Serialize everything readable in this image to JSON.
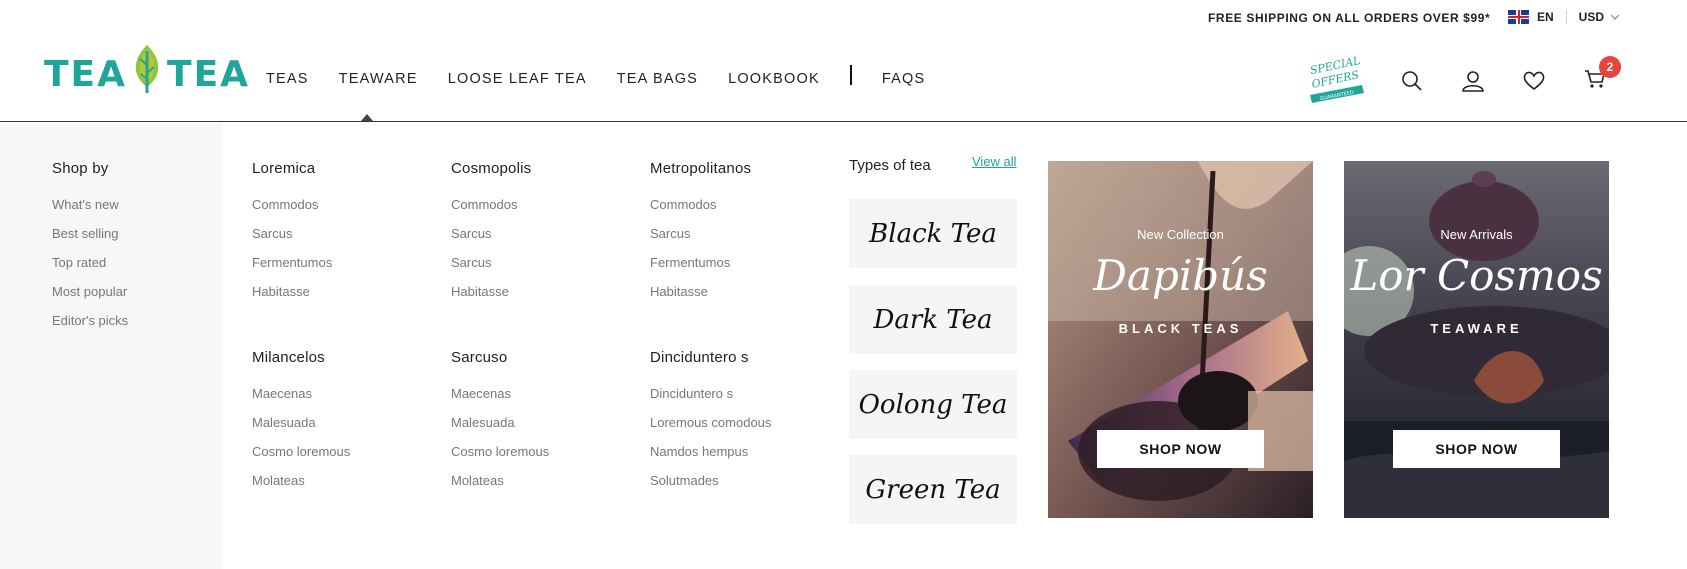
{
  "topbar": {
    "promo": "FREE SHIPPING ON ALL ORDERS OVER $99*",
    "language": "EN",
    "currency": "USD"
  },
  "logo": {
    "left": "TEA",
    "right": "TEA",
    "brand_color": "#20a59b"
  },
  "nav": {
    "items": [
      "TEAS",
      "TEAWARE",
      "LOOSE LEAF TEA",
      "TEA BAGS",
      "LOOKBOOK",
      "FAQS"
    ]
  },
  "special_offers": {
    "line1": "SPECIAL",
    "line2": "OFFERS",
    "ribbon": "GUARANTEED"
  },
  "cart": {
    "count": "2",
    "badge_color": "#e8443b"
  },
  "mega": {
    "shop_by": {
      "title": "Shop by",
      "items": [
        "What's new",
        "Best selling",
        "Top rated",
        "Most popular",
        "Editor's picks"
      ]
    },
    "columns": [
      {
        "title": "Loremica",
        "items": [
          "Commodos",
          "Sarcus",
          "Fermentumos",
          "Habitasse"
        ]
      },
      {
        "title": "Cosmopolis",
        "items": [
          "Commodos",
          "Sarcus",
          "Sarcus",
          "Habitasse"
        ]
      },
      {
        "title": "Metropolitanos",
        "items": [
          "Commodos",
          "Sarcus",
          "Fermentumos",
          "Habitasse"
        ]
      },
      {
        "title": "Milancelos",
        "items": [
          "Maecenas",
          "Malesuada",
          "Cosmo loremous",
          "Molateas"
        ]
      },
      {
        "title": "Sarcuso",
        "items": [
          "Maecenas",
          "Malesuada",
          "Cosmo loremous",
          "Molateas"
        ]
      },
      {
        "title": "Dinciduntero s",
        "items": [
          "Dinciduntero s",
          "Loremous comodous",
          "Namdos hempus",
          "Solutmades"
        ]
      }
    ],
    "types": {
      "title": "Types of tea",
      "view_all": "View all",
      "items": [
        "Black Tea",
        "Dark Tea",
        "Oolong Tea",
        "Green Tea"
      ]
    },
    "banners": [
      {
        "sub": "New Collection",
        "big": "Dapibús",
        "cat": "BLACK TEAS",
        "button": "SHOP NOW"
      },
      {
        "sub": "New Arrivals",
        "big": "Lor Cosmos",
        "cat": "TEAWARE",
        "button": "SHOP NOW"
      }
    ]
  }
}
